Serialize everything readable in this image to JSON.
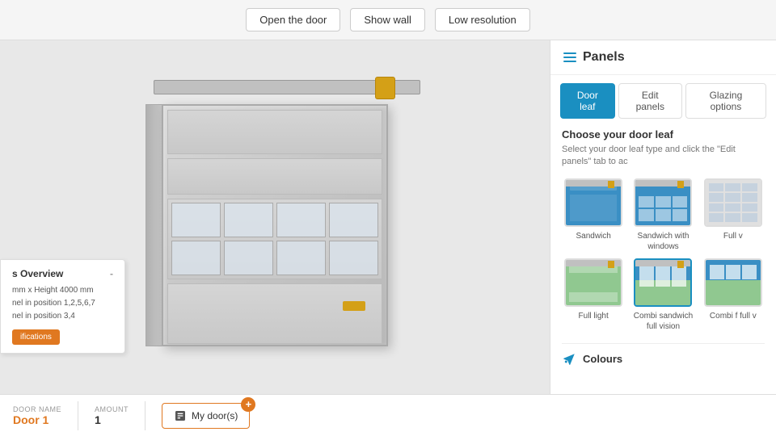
{
  "toolbar": {
    "open_door_label": "Open the door",
    "show_wall_label": "Show wall",
    "low_resolution_label": "Low resolution"
  },
  "overview": {
    "title": "s Overview",
    "collapse_label": "-",
    "line1": "mm x Height 4000 mm",
    "line2": "nel in position 1,2,5,6,7",
    "line3": "nel in position 3,4",
    "spec_button_label": "ifications"
  },
  "bottom_bar": {
    "door_name_label": "DOOR NAME",
    "door_name_value": "Door 1",
    "amount_label": "AMOUNT",
    "amount_value": "1",
    "my_doors_label": "My door(s)"
  },
  "right_panel": {
    "title": "Panels",
    "tabs": [
      {
        "id": "door-leaf",
        "label": "Door leaf",
        "active": true
      },
      {
        "id": "edit-panels",
        "label": "Edit panels",
        "active": false
      },
      {
        "id": "glazing-options",
        "label": "Glazing options",
        "active": false
      }
    ],
    "section_title": "Choose your door leaf",
    "section_subtitle": "Select your door leaf type and click the \"Edit panels\" tab to ac",
    "door_leaves": [
      {
        "id": "sandwich",
        "label": "Sandwich",
        "type": "sandwich",
        "selected": false
      },
      {
        "id": "sandwich-windows",
        "label": "Sandwich with windows",
        "type": "sandwich-windows",
        "selected": false
      },
      {
        "id": "full-vision",
        "label": "Full v",
        "type": "full-vision",
        "selected": false
      },
      {
        "id": "full-light",
        "label": "Full light",
        "type": "full-light",
        "selected": false
      },
      {
        "id": "combi-sandwich",
        "label": "Combi sandwich full vision",
        "type": "combi-sandwich",
        "selected": true
      },
      {
        "id": "combi-full",
        "label": "Combi f full v",
        "type": "combi-full",
        "selected": false
      }
    ],
    "colours_title": "Colours"
  }
}
